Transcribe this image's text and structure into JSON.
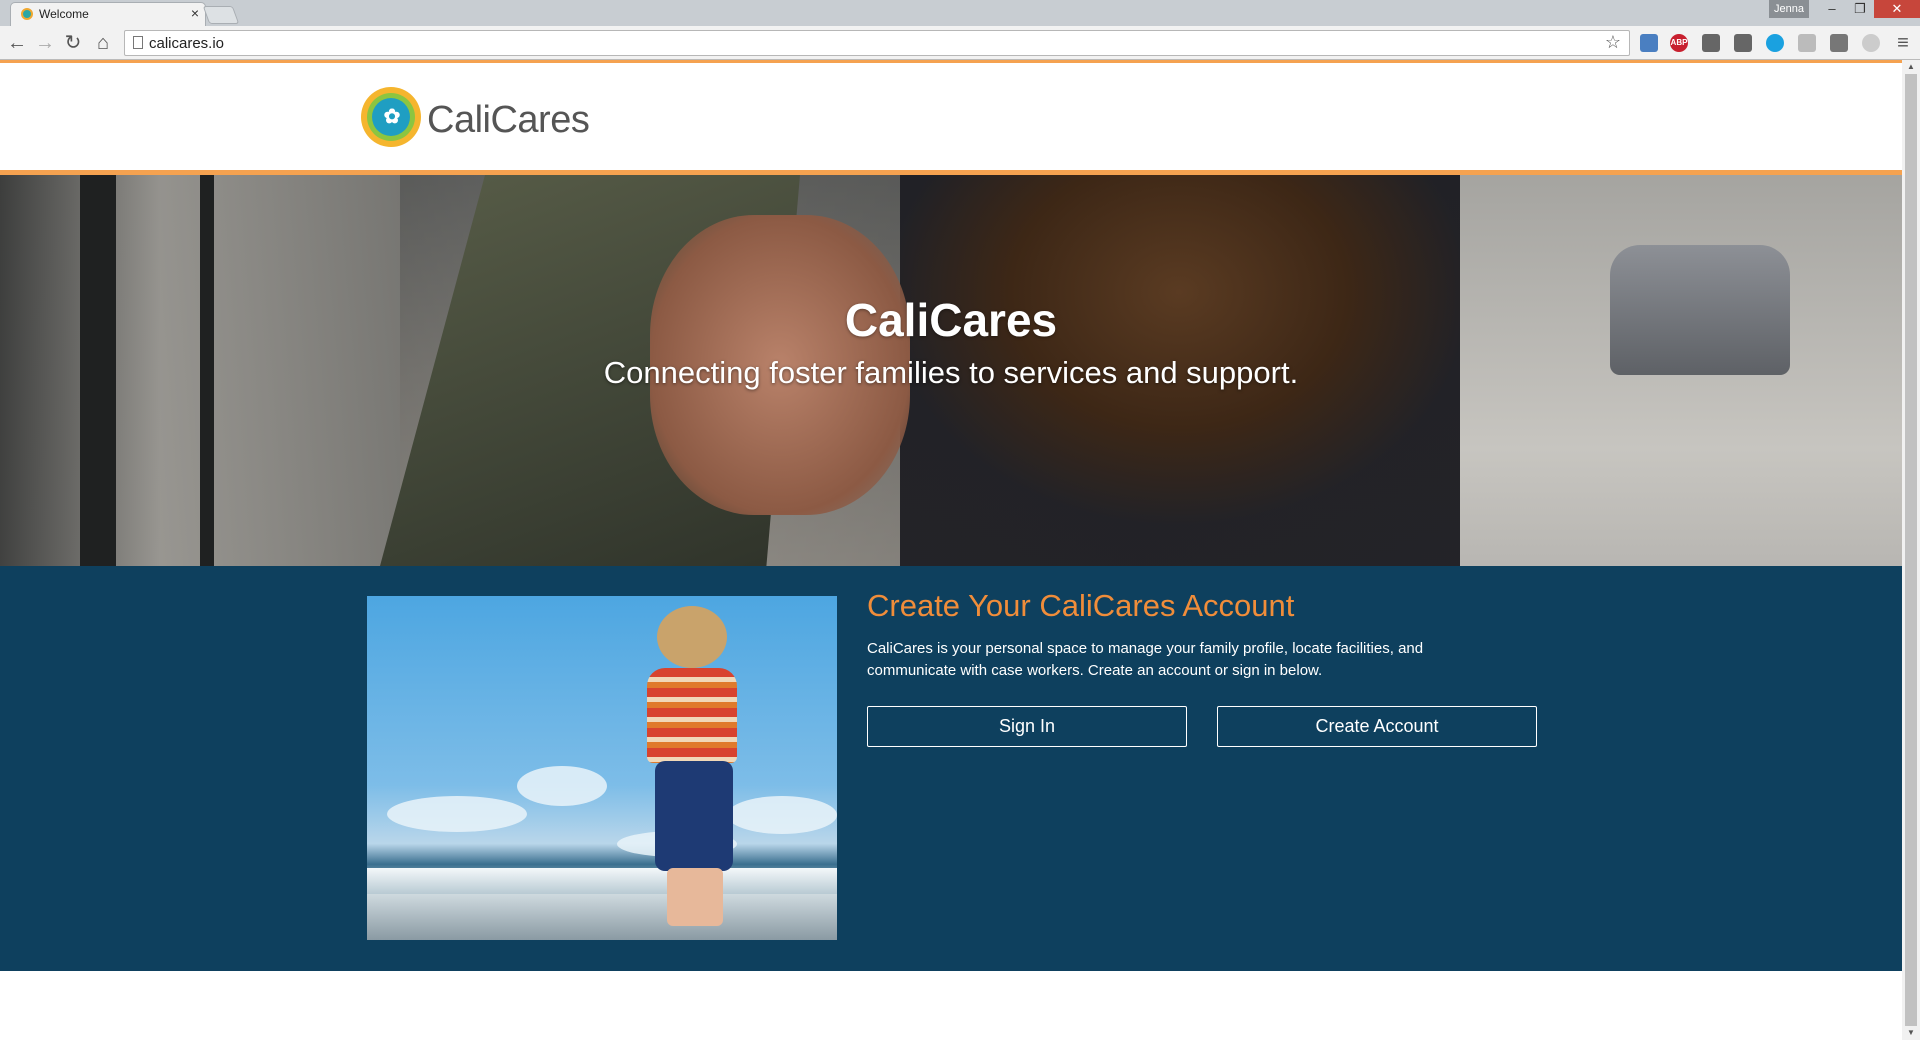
{
  "browser": {
    "tab_title": "Welcome",
    "tab_close": "×",
    "profile_name": "Jenna",
    "url": "calicares.io",
    "ext_abp": "ABP",
    "win_minimize": "–",
    "win_restore": "❐",
    "win_close": "✕",
    "nav_back": "←",
    "nav_forward": "→",
    "nav_reload": "↻",
    "nav_home": "⌂",
    "bookmark_star": "☆",
    "menu": "≡"
  },
  "site": {
    "brand": "CaliCares",
    "colors": {
      "accent_orange": "#f5a250",
      "navy": "#0e405e",
      "title_orange": "#f08d3a"
    }
  },
  "hero": {
    "title": "CaliCares",
    "subtitle": "Connecting foster families to services and support."
  },
  "account": {
    "title": "Create Your CaliCares Account",
    "description": "CaliCares is your personal space to manage your family profile, locate facilities, and communicate with case workers. Create an account or sign in below.",
    "sign_in_label": "Sign In",
    "create_label": "Create Account"
  }
}
